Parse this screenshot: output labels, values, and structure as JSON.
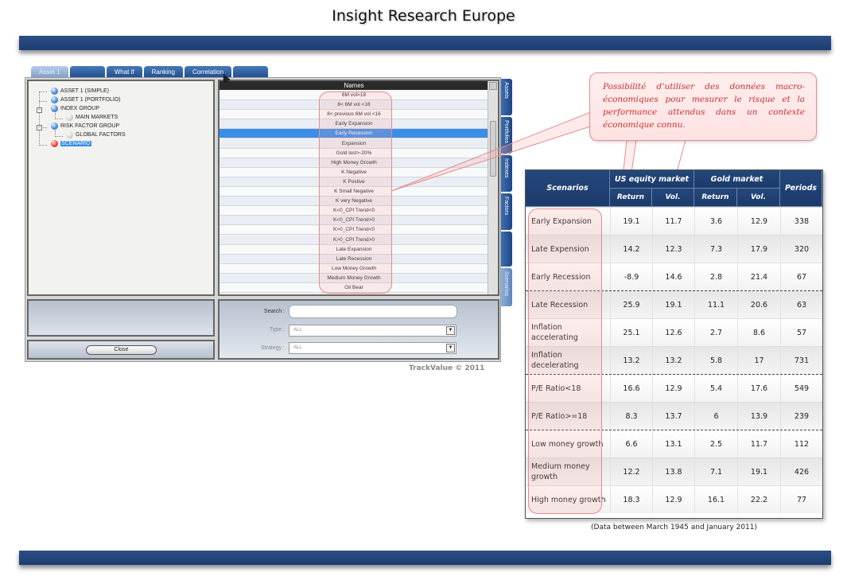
{
  "page_title": "Insight Research  Europe",
  "app": {
    "tabs": [
      "Asset 1",
      "",
      "What if",
      "Ranking",
      "Correlation",
      ""
    ],
    "tree": [
      {
        "label": "ASSET 1 (SIMPLE)",
        "dot": "blue"
      },
      {
        "label": "ASSET 1 (PORTFOLIO)",
        "dot": "blue"
      },
      {
        "label": "INDEX GROUP",
        "dot": "blue"
      },
      {
        "label": "MAIN MARKETS",
        "dot": "grey"
      },
      {
        "label": "RISK FACTOR GROUP",
        "dot": "blue"
      },
      {
        "label": "GLOBAL FACTORS",
        "dot": "grey"
      },
      {
        "label": "SCENARIO",
        "dot": "red"
      }
    ],
    "names_header": "Names",
    "names": [
      "6M vol>18",
      "8< 6M vol <16",
      "8< previous 6M vol <16",
      "Early Expansion",
      "Early Recession",
      "Expansion",
      "Gold lost>-20%",
      "High Money Growth",
      "K Negative",
      "K Postive",
      "K Small Negative",
      "K very Negative",
      "K<0_CPI Trend<0",
      "K<0_CPI Trend>0",
      "K>0_CPI Trend<0",
      "K>0_CPI Trend>0",
      "Late Expansion",
      "Late Recession",
      "Low Money Growth",
      "Medium Money Growth",
      "Oil Bear"
    ],
    "selected_name_index": 4,
    "side_tabs": [
      "Assets",
      "Portfolios",
      "Indexes",
      "Factors",
      "",
      "Scenarios"
    ],
    "close_label": "Close",
    "search_label": "Search :",
    "search_value": "",
    "type_label": "Type :",
    "type_value": "ALL",
    "strategy_label": "Strategy :",
    "strategy_value": "ALL",
    "copyright": "TrackValue © 2011"
  },
  "callout": "Possibilité d’utiliser des données macro-économiques pour mesurer le risque et la performance attendus dans un contexte économique connu.",
  "table": {
    "headers": {
      "scenarios": "Scenarios",
      "us": "US equity market",
      "gold": "Gold market",
      "periods": "Periods",
      "return": "Return",
      "vol": "Vol."
    },
    "rows": [
      {
        "name": "Early Expansion",
        "us_ret": "19.1",
        "us_vol": "11.7",
        "g_ret": "3.6",
        "g_vol": "12.9",
        "periods": "338"
      },
      {
        "name": "Late Expension",
        "us_ret": "14.2",
        "us_vol": "12.3",
        "g_ret": "7.3",
        "g_vol": "17.9",
        "periods": "320"
      },
      {
        "name": "Early Recession",
        "us_ret": "-8.9",
        "us_vol": "14.6",
        "g_ret": "2.8",
        "g_vol": "21.4",
        "periods": "67"
      },
      {
        "name": "Late Recession",
        "us_ret": "25.9",
        "us_vol": "19.1",
        "g_ret": "11.1",
        "g_vol": "20.6",
        "periods": "63"
      },
      {
        "name": "Inflation accelerating",
        "us_ret": "25.1",
        "us_vol": "12.6",
        "g_ret": "2.7",
        "g_vol": "8.6",
        "periods": "57"
      },
      {
        "name": "Inflation decelerating",
        "us_ret": "13.2",
        "us_vol": "13.2",
        "g_ret": "5.8",
        "g_vol": "17",
        "periods": "731"
      },
      {
        "name": "P/E Ratio<18",
        "us_ret": "16.6",
        "us_vol": "12.9",
        "g_ret": "5.4",
        "g_vol": "17.6",
        "periods": "549"
      },
      {
        "name": "P/E Ratio>=18",
        "us_ret": "8.3",
        "us_vol": "13.7",
        "g_ret": "6",
        "g_vol": "13.9",
        "periods": "239"
      },
      {
        "name": "Low money growth",
        "us_ret": "6.6",
        "us_vol": "13.1",
        "g_ret": "2.5",
        "g_vol": "11.7",
        "periods": "112"
      },
      {
        "name": "Medium money growth",
        "us_ret": "12.2",
        "us_vol": "13.8",
        "g_ret": "7.1",
        "g_vol": "19.1",
        "periods": "426"
      },
      {
        "name": "High money growth",
        "us_ret": "18.3",
        "us_vol": "12.9",
        "g_ret": "16.1",
        "g_vol": "22.2",
        "periods": "77"
      }
    ],
    "footnote": "(Data between  March 1945  and January 2011)"
  }
}
